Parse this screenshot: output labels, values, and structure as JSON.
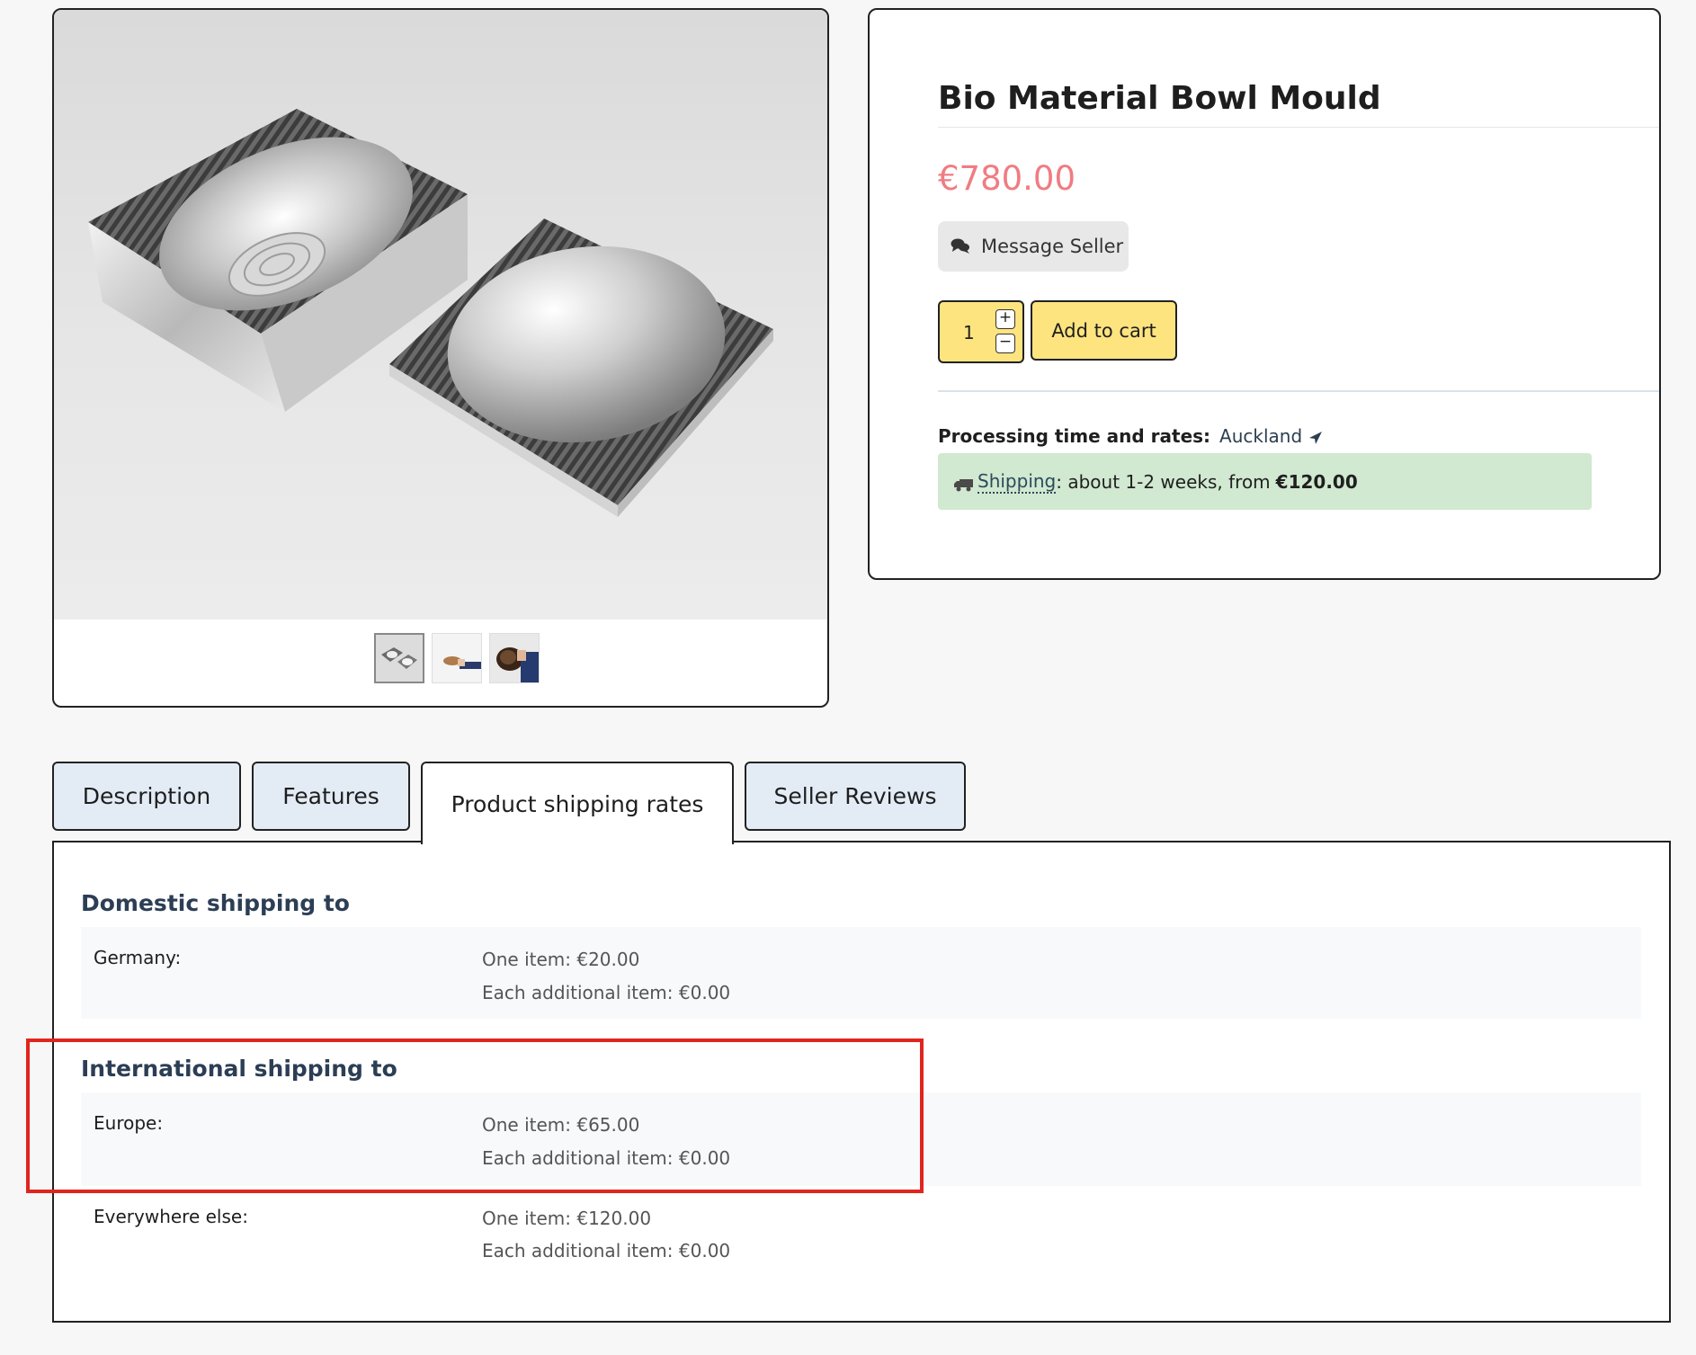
{
  "product": {
    "title": "Bio Material Bowl Mould",
    "price": "€780.00",
    "message_seller_label": "Message Seller",
    "quantity": "1",
    "qty_plus": "+",
    "qty_minus": "−",
    "add_to_cart_label": "Add to cart",
    "processing_label": "Processing time and rates:",
    "location": "Auckland",
    "shipping_link": "Shipping",
    "shipping_text": ": about 1-2 weeks, from",
    "shipping_from_price": "€120.00"
  },
  "gallery": {
    "thumbnails": [
      "bowl-mould",
      "hand-holding-bowl",
      "bowl-in-hands"
    ],
    "active_index": 0
  },
  "tabs": [
    {
      "label": "Description",
      "active": false
    },
    {
      "label": "Features",
      "active": false
    },
    {
      "label": "Product shipping rates",
      "active": true
    },
    {
      "label": "Seller Reviews",
      "active": false
    }
  ],
  "shipping_rates": {
    "domestic": {
      "title": "Domestic shipping to",
      "rows": [
        {
          "region": "Germany:",
          "one_item": "One item: €20.00",
          "additional": "Each additional item: €0.00"
        }
      ]
    },
    "international": {
      "title": "International shipping to",
      "rows": [
        {
          "region": "Europe:",
          "one_item": "One item: €65.00",
          "additional": "Each additional item: €0.00"
        },
        {
          "region": "Everywhere else:",
          "one_item": "One item: €120.00",
          "additional": "Each additional item: €0.00"
        }
      ]
    }
  },
  "colors": {
    "price": "#f07c82",
    "button_yellow": "#fde47f",
    "shipping_box": "#d1e8d1",
    "tab_inactive": "#e3ecf5",
    "highlight": "#e0251f"
  }
}
